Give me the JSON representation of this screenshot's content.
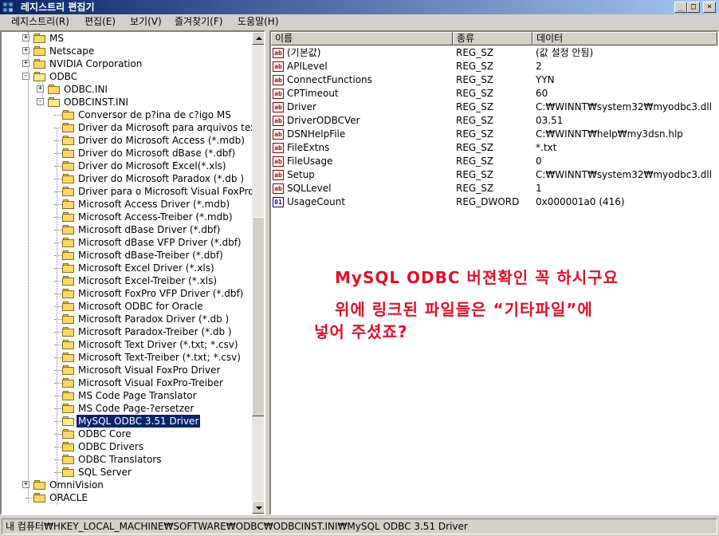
{
  "window": {
    "title": "레지스트리 편집기",
    "controls": {
      "minimize": "_",
      "maximize": "□",
      "close": "×"
    }
  },
  "menu": [
    "레지스트리(R)",
    "편집(E)",
    "보기(V)",
    "즐겨찾기(F)",
    "도움말(H)"
  ],
  "tree": {
    "nodes": [
      {
        "label": "MS",
        "expander": "+"
      },
      {
        "label": "Netscape",
        "expander": "+"
      },
      {
        "label": "NVIDIA Corporation",
        "expander": "+"
      },
      {
        "label": "ODBC",
        "expander": "-"
      },
      {
        "label": "ODBC.INI",
        "expander": "+"
      },
      {
        "label": "ODBCINST.INI",
        "expander": "-"
      },
      {
        "label": "Conversor de p?ina de c?igo MS"
      },
      {
        "label": "Driver da Microsoft para arquivos text"
      },
      {
        "label": "Driver do Microsoft Access (*.mdb)"
      },
      {
        "label": "Driver do Microsoft dBase (*.dbf)"
      },
      {
        "label": "Driver do Microsoft Excel(*.xls)"
      },
      {
        "label": "Driver do Microsoft Paradox (*.db )"
      },
      {
        "label": "Driver para o Microsoft Visual FoxPro"
      },
      {
        "label": "Microsoft Access Driver (*.mdb)"
      },
      {
        "label": "Microsoft Access-Treiber (*.mdb)"
      },
      {
        "label": "Microsoft dBase Driver (*.dbf)"
      },
      {
        "label": "Microsoft dBase VFP Driver (*.dbf)"
      },
      {
        "label": "Microsoft dBase-Treiber (*.dbf)"
      },
      {
        "label": "Microsoft Excel Driver (*.xls)"
      },
      {
        "label": "Microsoft Excel-Treiber (*.xls)"
      },
      {
        "label": "Microsoft FoxPro VFP Driver (*.dbf)"
      },
      {
        "label": "Microsoft ODBC for Oracle"
      },
      {
        "label": "Microsoft Paradox Driver (*.db )"
      },
      {
        "label": "Microsoft Paradox-Treiber (*.db )"
      },
      {
        "label": "Microsoft Text Driver (*.txt; *.csv)"
      },
      {
        "label": "Microsoft Text-Treiber (*.txt; *.csv)"
      },
      {
        "label": "Microsoft Visual FoxPro Driver"
      },
      {
        "label": "Microsoft Visual FoxPro-Treiber"
      },
      {
        "label": "MS Code Page Translator"
      },
      {
        "label": "MS Code Page-?ersetzer"
      },
      {
        "label": "MySQL ODBC 3.51 Driver",
        "selected": true
      },
      {
        "label": "ODBC Core"
      },
      {
        "label": "ODBC Drivers"
      },
      {
        "label": "ODBC Translators"
      },
      {
        "label": "SQL Server"
      },
      {
        "label": "OmniVision",
        "expander": "+"
      },
      {
        "label": "ORACLE"
      }
    ]
  },
  "list": {
    "columns": [
      "이름",
      "종류",
      "데이터"
    ],
    "rows": [
      {
        "icon": "string-value-icon",
        "name": "(기본값)",
        "type": "REG_SZ",
        "data": "(값 설정 안됨)"
      },
      {
        "icon": "string-value-icon",
        "name": "APILevel",
        "type": "REG_SZ",
        "data": "2"
      },
      {
        "icon": "string-value-icon",
        "name": "ConnectFunctions",
        "type": "REG_SZ",
        "data": "YYN"
      },
      {
        "icon": "string-value-icon",
        "name": "CPTimeout",
        "type": "REG_SZ",
        "data": "60"
      },
      {
        "icon": "string-value-icon",
        "name": "Driver",
        "type": "REG_SZ",
        "data": "C:₩WINNT₩system32₩myodbc3.dll"
      },
      {
        "icon": "string-value-icon",
        "name": "DriverODBCVer",
        "type": "REG_SZ",
        "data": "03.51"
      },
      {
        "icon": "string-value-icon",
        "name": "DSNHelpFile",
        "type": "REG_SZ",
        "data": "C:₩WINNT₩help₩my3dsn.hlp"
      },
      {
        "icon": "string-value-icon",
        "name": "FileExtns",
        "type": "REG_SZ",
        "data": "*.txt"
      },
      {
        "icon": "string-value-icon",
        "name": "FileUsage",
        "type": "REG_SZ",
        "data": "0"
      },
      {
        "icon": "string-value-icon",
        "name": "Setup",
        "type": "REG_SZ",
        "data": "C:₩WINNT₩system32₩myodbc3.dll"
      },
      {
        "icon": "string-value-icon",
        "name": "SQLLevel",
        "type": "REG_SZ",
        "data": "1"
      },
      {
        "icon": "dword-value-icon",
        "name": "UsageCount",
        "type": "REG_DWORD",
        "data": "0x000001a0 (416)"
      }
    ]
  },
  "annotation": {
    "lines": [
      "MySQL ODBC 버젼확인 꼭 하시구요",
      "위에 링크된 파일들은 “기타파일”에",
      "넣어 주셨죠?"
    ],
    "color": "#e0102a"
  },
  "status": "내 컴퓨터₩HKEY_LOCAL_MACHINE₩SOFTWARE₩ODBC₩ODBCINST.INI₩MySQL ODBC 3.51 Driver"
}
